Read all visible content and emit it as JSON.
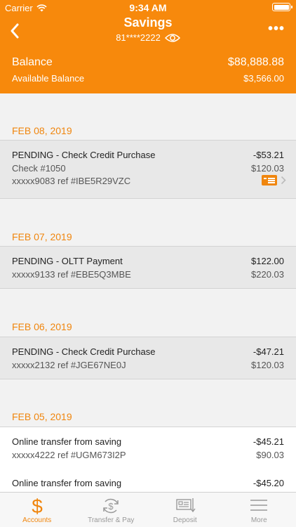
{
  "status": {
    "carrier": "Carrier",
    "time": "9:34 AM"
  },
  "header": {
    "title": "Savings",
    "account_masked": "81****2222",
    "balance_label": "Balance",
    "balance_value": "$88,888.88",
    "available_label": "Available Balance",
    "available_value": "$3,566.00"
  },
  "groups": [
    {
      "date": "FEB 08, 2019",
      "transactions": [
        {
          "desc": "PENDING - Check Credit Purchase",
          "line2": "Check #1050",
          "line3": "xxxxx9083 ref #IBE5R29VZC",
          "amount": "-$53.21",
          "balance": "$120.03",
          "has_check_icon": true
        }
      ]
    },
    {
      "date": "FEB 07, 2019",
      "transactions": [
        {
          "desc": "PENDING - OLTT Payment",
          "line2": "xxxxx9133 ref #EBE5Q3MBE",
          "amount": "$122.00",
          "balance": "$220.03"
        }
      ]
    },
    {
      "date": "FEB 06, 2019",
      "transactions": [
        {
          "desc": "PENDING - Check Credit Purchase",
          "line2": "xxxxx2132 ref #JGE67NE0J",
          "amount": "-$47.21",
          "balance": "$120.03"
        }
      ]
    },
    {
      "date": "FEB 05, 2019",
      "transactions": [
        {
          "desc": "Online transfer from saving",
          "line2": "xxxxx4222 ref #UGM673I2P",
          "amount": "-$45.21",
          "balance": "$90.03"
        },
        {
          "desc": "Online transfer from saving",
          "amount": "-$45.20"
        }
      ]
    }
  ],
  "tabs": [
    {
      "label": "Accounts",
      "icon": "dollar-icon",
      "active": true
    },
    {
      "label": "Transfer & Pay",
      "icon": "transfer-icon",
      "active": false
    },
    {
      "label": "Deposit",
      "icon": "deposit-check-icon",
      "active": false
    },
    {
      "label": "More",
      "icon": "menu-icon",
      "active": false
    }
  ],
  "colors": {
    "brand": "#f7890c",
    "date_text": "#f0860e",
    "pending_bg": "#e8e8e8"
  }
}
